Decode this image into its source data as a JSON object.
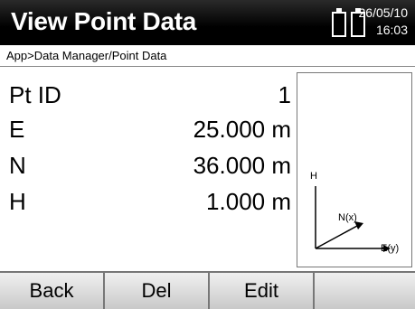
{
  "header": {
    "title": "View Point Data",
    "date": "26/05/10",
    "time": "16:03"
  },
  "breadcrumb": "App>Data Manager/Point Data",
  "fields": [
    {
      "label": "Pt ID",
      "value": "1"
    },
    {
      "label": "E",
      "value": "25.000 m"
    },
    {
      "label": "N",
      "value": "36.000 m"
    },
    {
      "label": "H",
      "value": "1.000 m"
    }
  ],
  "diagram": {
    "h_label": "H",
    "n_label": "N(x)",
    "e_label": "E(y)"
  },
  "toolbar": {
    "back": "Back",
    "del": "Del",
    "edit": "Edit"
  },
  "icons": {
    "battery": "battery-icon"
  }
}
